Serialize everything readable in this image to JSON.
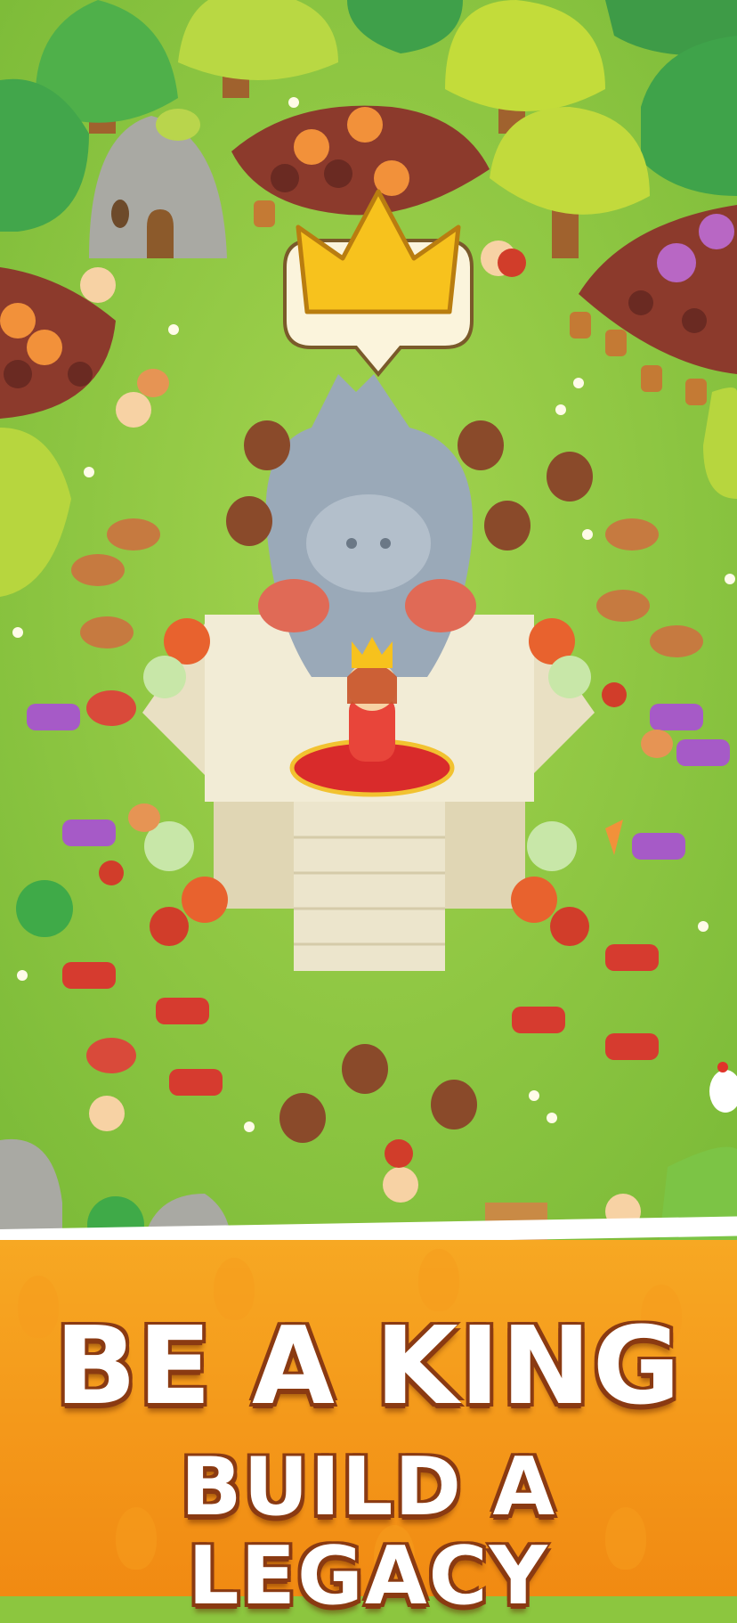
{
  "headline": "BE A KING",
  "subheadline": "BUILD A LEGACY",
  "colors": {
    "grass": "#8cc63f",
    "banner": "#f39a1a",
    "crown": "#f7c21d",
    "statue": "#9aa9b8",
    "temple": "#f2ecd6"
  },
  "icons": [
    "crown-icon",
    "meat-icon",
    "carrot-icon",
    "tomato-icon",
    "chicken-leg-icon",
    "cabbage-icon"
  ]
}
